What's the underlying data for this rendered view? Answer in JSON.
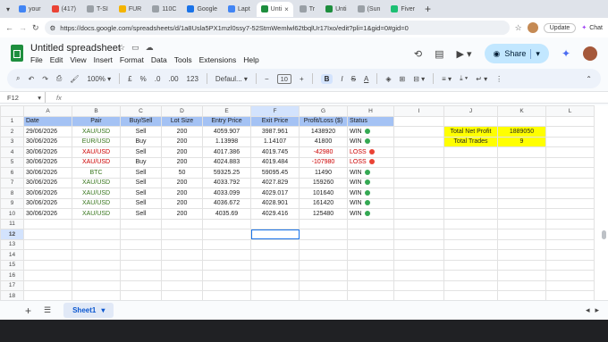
{
  "browser": {
    "tabs": [
      {
        "label": "your",
        "color": "#4285f4"
      },
      {
        "label": "(417)",
        "color": "#ea4335"
      },
      {
        "label": "T-SI",
        "color": "#9aa0a6"
      },
      {
        "label": "FUR",
        "color": "#f4b400"
      },
      {
        "label": "110C",
        "color": "#9aa0a6"
      },
      {
        "label": "Google",
        "color": "#1a73e8"
      },
      {
        "label": "Lapt",
        "color": "#4285f4"
      },
      {
        "label": "Unti",
        "color": "#1e8e3e",
        "active": true
      },
      {
        "label": "Tr",
        "color": "#9aa0a6"
      },
      {
        "label": "Unti",
        "color": "#1e8e3e"
      },
      {
        "label": "(Sun",
        "color": "#9aa0a6"
      },
      {
        "label": "Fiver",
        "color": "#1dbf73"
      }
    ],
    "url": "https://docs.google.com/spreadsheets/d/1a8Usla5PX1mzl0ssy7-52StmWemlwl62tbqlUr17Ixo/edit?pli=1&gid=0#gid=0",
    "update_label": "Update",
    "chat_label": "Chat"
  },
  "app": {
    "title": "Untitled spreadsheet",
    "menu": [
      "File",
      "Edit",
      "View",
      "Insert",
      "Format",
      "Data",
      "Tools",
      "Extensions",
      "Help"
    ],
    "share_label": "Share"
  },
  "toolbar": {
    "zoom": "100%",
    "currency": "£",
    "percent": "%",
    "dec_down": ".0",
    "dec_up": ".00",
    "num_format": "123",
    "font": "Defaul...",
    "font_size": "10",
    "bold": "B",
    "italic": "I",
    "strike": "S",
    "text_color": "A"
  },
  "formula_bar": {
    "cell_ref": "F12",
    "fx": "fx"
  },
  "grid": {
    "columns": [
      "A",
      "B",
      "C",
      "D",
      "E",
      "F",
      "G",
      "H",
      "I",
      "J",
      "K",
      "L"
    ],
    "rows": [
      "1",
      "2",
      "3",
      "4",
      "5",
      "6",
      "7",
      "8",
      "9",
      "10",
      "11",
      "12",
      "13",
      "14",
      "15",
      "16",
      "17",
      "18"
    ],
    "headers": [
      "Date",
      "Pair",
      "Buy/Sell",
      "Lot Size",
      "Entry Price",
      "Exit Price",
      "Profit/Loss ($)",
      "Status"
    ],
    "trades": [
      {
        "date": "29/06/2026",
        "pair": "XAU/USD",
        "pair_color": "green",
        "side": "Sell",
        "lot": "200",
        "entry": "4059.907",
        "exit": "3987.961",
        "pl": "1438920",
        "status": "WIN"
      },
      {
        "date": "30/06/2026",
        "pair": "EUR/USD",
        "pair_color": "green",
        "side": "Buy",
        "lot": "200",
        "entry": "1.13998",
        "exit": "1.14107",
        "pl": "41800",
        "status": "WIN"
      },
      {
        "date": "30/06/2026",
        "pair": "XAU/USD",
        "pair_color": "red",
        "side": "Sell",
        "lot": "200",
        "entry": "4017.386",
        "exit": "4019.745",
        "pl": "-42980",
        "status": "LOSS"
      },
      {
        "date": "30/06/2026",
        "pair": "XAU/USD",
        "pair_color": "red",
        "side": "Buy",
        "lot": "200",
        "entry": "4024.883",
        "exit": "4019.484",
        "pl": "-107980",
        "status": "LOSS"
      },
      {
        "date": "30/06/2026",
        "pair": "BTC",
        "pair_color": "green",
        "side": "Sell",
        "lot": "50",
        "entry": "59325.25",
        "exit": "59095.45",
        "pl": "11490",
        "status": "WIN"
      },
      {
        "date": "30/06/2026",
        "pair": "XAU/USD",
        "pair_color": "green",
        "side": "Sell",
        "lot": "200",
        "entry": "4033.792",
        "exit": "4027.829",
        "pl": "159260",
        "status": "WIN"
      },
      {
        "date": "30/06/2026",
        "pair": "XAU/USD",
        "pair_color": "green",
        "side": "Sell",
        "lot": "200",
        "entry": "4033.099",
        "exit": "4029.017",
        "pl": "101640",
        "status": "WIN"
      },
      {
        "date": "30/06/2026",
        "pair": "XAU/USD",
        "pair_color": "green",
        "side": "Sell",
        "lot": "200",
        "entry": "4036.672",
        "exit": "4028.901",
        "pl": "161420",
        "status": "WIN"
      },
      {
        "date": "30/06/2026",
        "pair": "XAU/USD",
        "pair_color": "green",
        "side": "Sell",
        "lot": "200",
        "entry": "4035.69",
        "exit": "4029.416",
        "pl": "125480",
        "status": "WIN"
      }
    ],
    "summary": {
      "net_label": "Total Net Profit",
      "net_value": "1889050",
      "trades_label": "Total Trades",
      "trades_value": "9"
    },
    "selected_cell": "F12"
  },
  "sheets": {
    "active": "Sheet1"
  },
  "colors": {
    "header_fill": "#a4c2f4",
    "summary_fill": "#ffff00",
    "win_dot": "#34a853",
    "loss_dot": "#ea4335",
    "accent": "#1a73e8"
  }
}
